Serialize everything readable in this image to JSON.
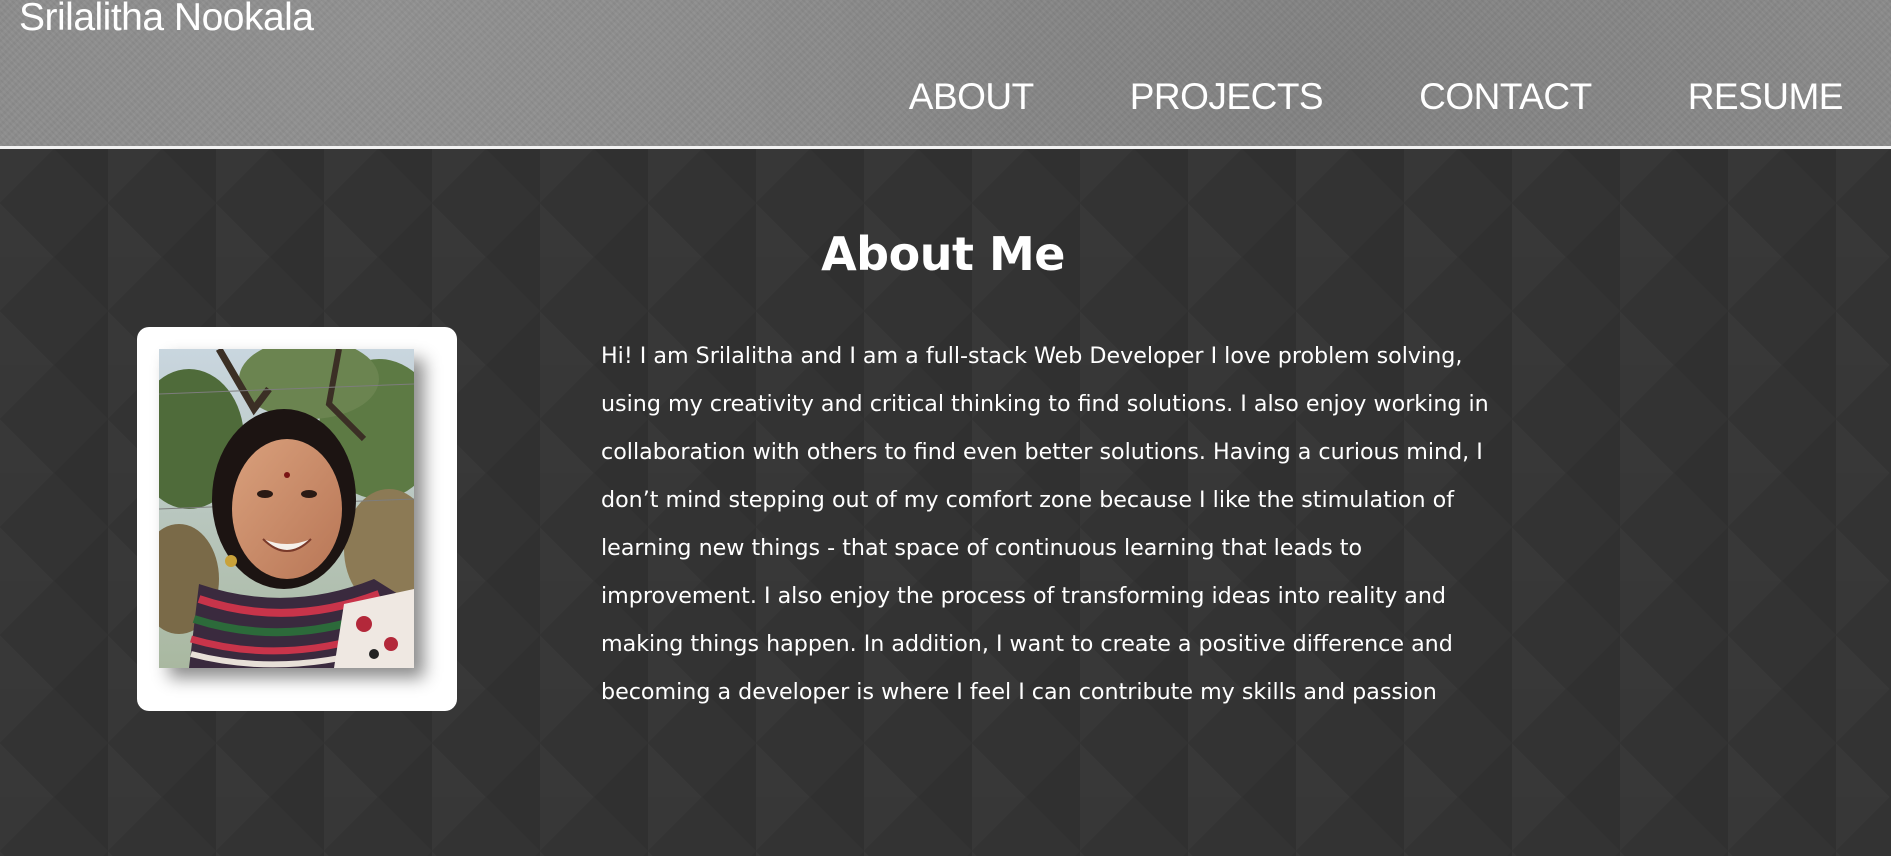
{
  "header": {
    "brand": "Srilalitha Nookala",
    "nav": [
      {
        "label": "ABOUT"
      },
      {
        "label": "PROJECTS"
      },
      {
        "label": "CONTACT"
      },
      {
        "label": "RESUME"
      }
    ]
  },
  "about": {
    "title": "About Me",
    "bio": "Hi! I am Srilalitha and I am a full-stack Web Developer I love problem solving, using my creativity and critical thinking to find solutions. I also enjoy working in collaboration with others to find even better solutions. Having a curious mind, I don’t mind stepping out of my comfort zone because I like the stimulation of learning new things - that space of continuous learning that leads to improvement. I also enjoy the process of transforming ideas into reality and making things happen. In addition, I want to create a positive difference and becoming a developer is where I feel I can contribute my skills and passion"
  },
  "colors": {
    "header_bg": "#8a8a8a",
    "main_bg": "#333333",
    "text": "#ffffff",
    "card_bg": "#ffffff"
  }
}
